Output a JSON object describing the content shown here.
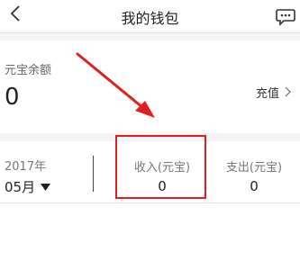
{
  "header": {
    "title": "我的钱包"
  },
  "balance": {
    "label": "元宝余额",
    "value": "0",
    "recharge_label": "充值"
  },
  "stats": {
    "year": "2017年",
    "month": "05月",
    "income_label": "收入(元宝)",
    "income_value": "0",
    "expense_label": "支出(元宝)",
    "expense_value": "0"
  },
  "icons": {
    "back": "chevron-left-icon",
    "message": "chat-bubble-icon",
    "recharge": "chevron-right-icon",
    "month": "caret-down-icon"
  },
  "colors": {
    "annotation": "#e02020",
    "section_gap": "#f4f4f4"
  }
}
